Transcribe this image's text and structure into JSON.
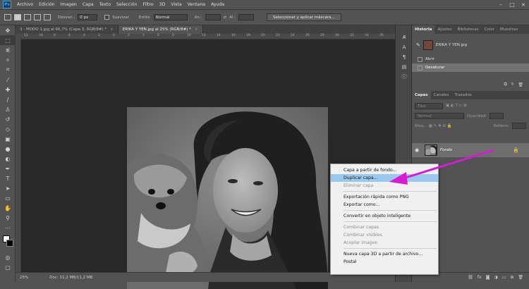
{
  "menubar": {
    "logo": "Ps",
    "items": [
      "Archivo",
      "Edición",
      "Imagen",
      "Capa",
      "Texto",
      "Selección",
      "Filtro",
      "3D",
      "Vista",
      "Ventana",
      "Ayuda"
    ],
    "controls": [
      "–",
      "□",
      "×"
    ]
  },
  "options": {
    "feather_label": "Desvan.:",
    "feather_value": "0 px",
    "smooth_label": "Suavizar",
    "style_label": "Estilo:",
    "style_value": "Normal",
    "width_label": "An.:",
    "height_label": "Al.:",
    "select_mask_button": "Seleccionar y aplicar máscara..."
  },
  "tabs": [
    {
      "label": "3 - MODO 1.jpg al 66,7% (Capa 3, RGB/8#) *",
      "close": "×"
    },
    {
      "label": "ERIKA Y YEN.jpg al 25% (RGB/8#) *",
      "close": "×"
    }
  ],
  "ruler": {
    "ticks": [
      "12",
      "10",
      "8",
      "6",
      "4",
      "2",
      "0",
      "2",
      "4",
      "6",
      "8",
      "10",
      "12",
      "14",
      "16",
      "18",
      "20",
      "22",
      "24",
      "26",
      "28",
      "30",
      "32",
      "34",
      "36",
      "38"
    ]
  },
  "status": {
    "zoom": "25%",
    "doc": "Doc: 11,2 MB/11,2 MB"
  },
  "history_panel": {
    "tabs": [
      "Historia",
      "Ajustes",
      "Bibliotecas",
      "Color",
      "Muestras"
    ],
    "snapshot": "ERIKA Y YEN.jpg",
    "steps": [
      {
        "label": "Abrir",
        "selected": false
      },
      {
        "label": "Desaturar",
        "selected": true
      }
    ]
  },
  "layers_panel": {
    "tabs": [
      "Capas",
      "Canales",
      "Trazados"
    ],
    "filter_placeholder": "Tipo",
    "blend_mode": "Normal",
    "opacity_label": "Opacidad:",
    "lock_label": "Bloq.:",
    "fill_label": "Relleno:",
    "layer_name": "Fondo"
  },
  "context_menu": {
    "items": [
      {
        "label": "Capa a partir de fondo...",
        "enabled": true,
        "highlighted": false
      },
      {
        "label": "Duplicar capa...",
        "enabled": true,
        "highlighted": true
      },
      {
        "label": "Eliminar capa",
        "enabled": false,
        "highlighted": false
      },
      {
        "separator": true
      },
      {
        "label": "Exportación rápida como PNG",
        "enabled": true,
        "highlighted": false
      },
      {
        "label": "Exportar como...",
        "enabled": true,
        "highlighted": false
      },
      {
        "separator": true
      },
      {
        "label": "Convertir en objeto inteligente",
        "enabled": true,
        "highlighted": false
      },
      {
        "separator": true
      },
      {
        "label": "Combinar capas",
        "enabled": false,
        "highlighted": false
      },
      {
        "label": "Combinar visibles",
        "enabled": false,
        "highlighted": false
      },
      {
        "label": "Acoplar imagen",
        "enabled": false,
        "highlighted": false
      },
      {
        "separator": true
      },
      {
        "label": "Nueva capa 3D a partir de archivo...",
        "enabled": true,
        "highlighted": false
      },
      {
        "label": "Postal",
        "enabled": true,
        "highlighted": false
      }
    ]
  },
  "colors": {
    "arrow": "#d61cd2",
    "highlight": "#99c9ef",
    "workspace": "#282828",
    "ui": "#535353"
  }
}
